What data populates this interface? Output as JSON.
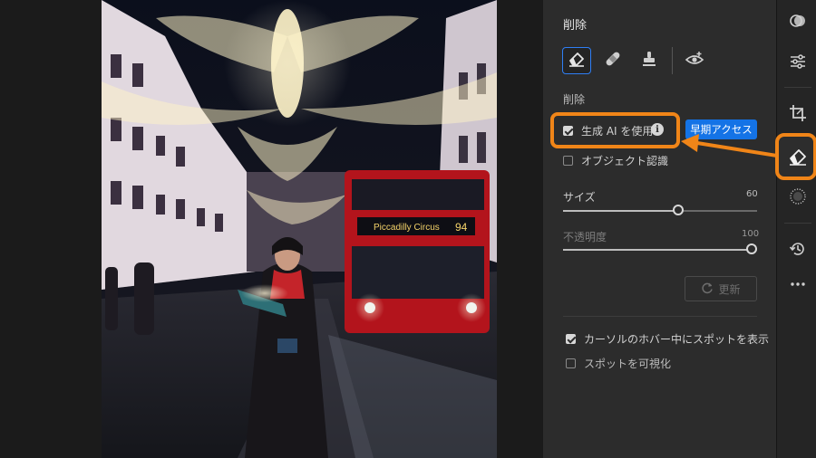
{
  "panel": {
    "title": "削除",
    "section_label": "削除",
    "generative_ai": {
      "label": "生成 AI を使用",
      "checked": true,
      "info_glyph": "i"
    },
    "early_access": "早期アクセス",
    "object_detection": {
      "label": "オブジェクト認識",
      "checked": false
    },
    "size": {
      "label": "サイズ",
      "value": "60",
      "fraction": 0.6
    },
    "opacity": {
      "label": "不透明度",
      "value": "100",
      "fraction": 1.0
    },
    "refresh_label": "更新",
    "show_spot_on_hover": {
      "label": "カーソルのホバー中にスポットを表示",
      "checked": true
    },
    "visualize_spots": {
      "label": "スポットを可視化",
      "checked": false
    }
  },
  "tools": [
    "eraser-icon",
    "bandage-icon",
    "stamp-icon",
    "red-eye-icon"
  ],
  "rail": [
    "masking-icon",
    "sliders-icon",
    "crop-icon",
    "eraser-icon",
    "blur-icon",
    "history-icon",
    "more-icon"
  ],
  "colors": {
    "accent": "#f08518",
    "selection": "#2f7ff5",
    "badge": "#1473e6"
  }
}
